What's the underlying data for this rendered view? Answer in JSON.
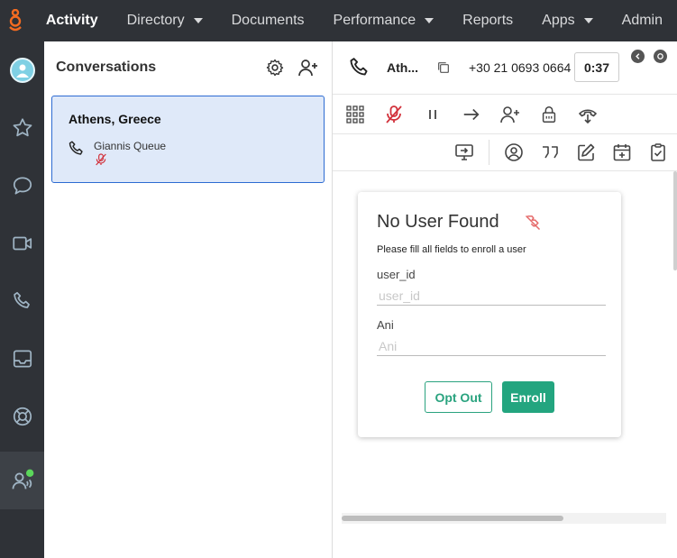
{
  "brand": {
    "accent": "#f26b21",
    "nav_bg": "#2f3237",
    "primary": "#23a57f"
  },
  "topnav": {
    "items": [
      {
        "label": "Activity",
        "has_dropdown": false,
        "active": true
      },
      {
        "label": "Directory",
        "has_dropdown": true,
        "active": false
      },
      {
        "label": "Documents",
        "has_dropdown": false,
        "active": false
      },
      {
        "label": "Performance",
        "has_dropdown": true,
        "active": false
      },
      {
        "label": "Reports",
        "has_dropdown": false,
        "active": false
      },
      {
        "label": "Apps",
        "has_dropdown": true,
        "active": false
      },
      {
        "label": "Admin",
        "has_dropdown": false,
        "active": false
      }
    ]
  },
  "rail": {
    "icons": [
      "avatar",
      "star-icon",
      "chat-icon",
      "video-icon",
      "phone-icon",
      "inbox-icon",
      "lifebuoy-icon",
      "agent-status-icon"
    ],
    "status_color": "#5bd75b"
  },
  "conversations": {
    "title": "Conversations",
    "items": [
      {
        "title": "Athens, Greece",
        "queue": "Giannis Queue",
        "muted": true
      }
    ]
  },
  "call": {
    "name": "Ath...",
    "number": "+30 21 0693 0664",
    "timer": "0:37",
    "toolbar": [
      "dialpad-icon",
      "mute-icon",
      "hold-icon",
      "transfer-icon",
      "add-participant-icon",
      "secure-pause-icon",
      "park-icon"
    ],
    "toolbar2": [
      "screen-share-icon",
      "contact-icon",
      "quote-icon",
      "edit-icon",
      "calendar-add-icon",
      "clipboard-check-icon"
    ]
  },
  "enroll_card": {
    "title": "No User Found",
    "subtitle": "Please fill all fields to enroll a user",
    "fields": [
      {
        "label": "user_id",
        "placeholder": "user_id",
        "value": ""
      },
      {
        "label": "Ani",
        "placeholder": "Ani",
        "value": ""
      }
    ],
    "opt_out_label": "Opt Out",
    "enroll_label": "Enroll"
  }
}
